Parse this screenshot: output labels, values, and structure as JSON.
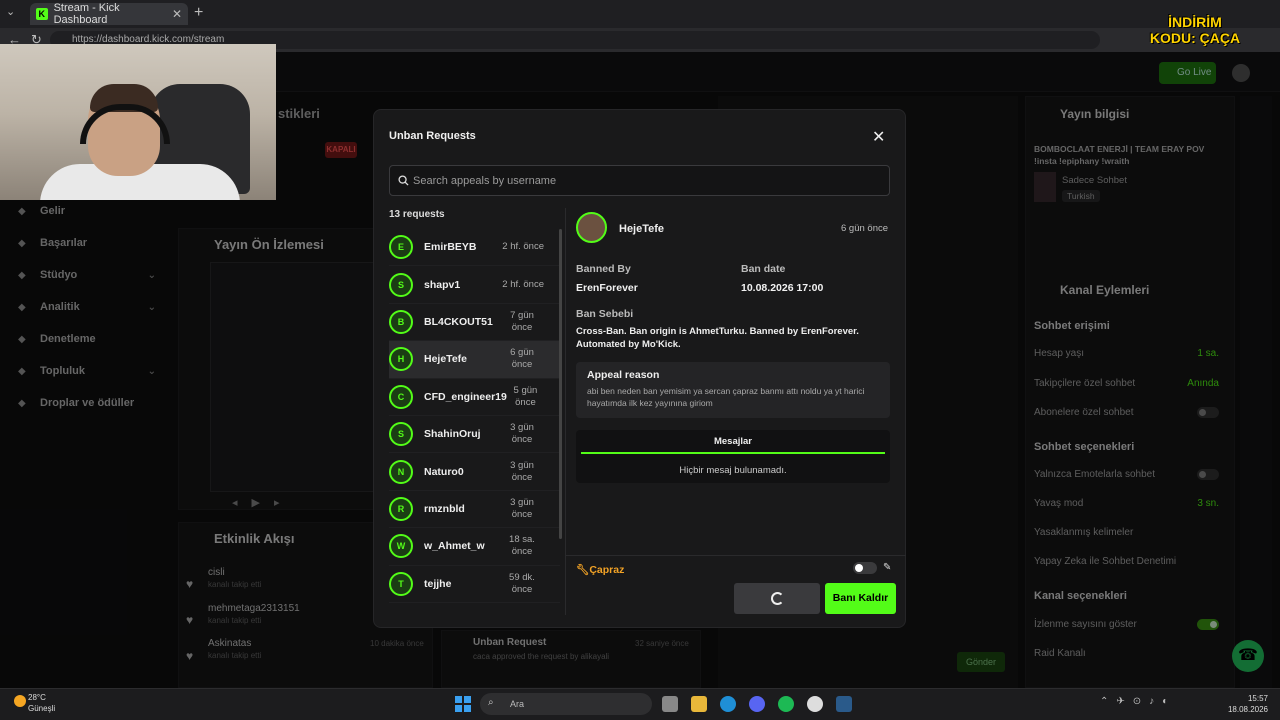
{
  "browser": {
    "tab_title": "Stream - Kick Dashboard",
    "url": "https://dashboard.kick.com/stream",
    "promo": "İNDİRİM KODU: ÇAÇA"
  },
  "dashboard": {
    "go_live": "Go Live",
    "stats_title": "stikleri",
    "status_badge": "KAPALI",
    "sidebar": [
      {
        "label": "Gelir",
        "icon": "dollar-icon",
        "chevron": false
      },
      {
        "label": "Başarılar",
        "icon": "trophy-icon",
        "chevron": false
      },
      {
        "label": "Stüdyo",
        "icon": "studio-icon",
        "chevron": true
      },
      {
        "label": "Analitik",
        "icon": "chart-icon",
        "chevron": true
      },
      {
        "label": "Denetleme",
        "icon": "wrench-icon",
        "chevron": false
      },
      {
        "label": "Topluluk",
        "icon": "users-icon",
        "chevron": true
      },
      {
        "label": "Droplar ve ödüller",
        "icon": "gift-icon",
        "chevron": false
      }
    ],
    "preview_title": "Yayın Ön İzlemesi",
    "activity_title": "Etkinlik Akışı",
    "activity": [
      {
        "user": "cisli",
        "sub": "kanalı takip etti"
      },
      {
        "user": "mehmetaga2313151",
        "sub": "kanalı takip etti"
      },
      {
        "user": "Askinatas",
        "sub": "kanalı takip etti",
        "time": "10 dakika önce"
      }
    ],
    "unban_log": {
      "title": "Unban Request",
      "sub": "caca approved the request by alikayali",
      "time": "32 saniye önce"
    },
    "chat_send": "Gönder",
    "stream_info": {
      "title": "Yayın bilgisi",
      "stream_name": "BOMBOCLAAT ENERJİ | TEAM ERAY POV !insta !epiphany !wraith",
      "category": "Sadece Sohbet",
      "tag": "Turkish"
    },
    "channel_actions": {
      "title": "Kanal Eylemleri",
      "chat_access": "Sohbet erişimi",
      "account_age": "Hesap yaşı",
      "account_age_val": "1 sa.",
      "followers_only": "Takipçilere özel sohbet",
      "followers_only_val": "Anında",
      "subs_only": "Abonelere özel sohbet",
      "chat_options": "Sohbet seçenekleri",
      "emotes_only": "Yalnızca Emotelarla sohbet",
      "slow_mode": "Yavaş mod",
      "slow_mode_val": "3 sn.",
      "banned_words": "Yasaklanmış kelimeler",
      "ai_moderation": "Yapay Zeka ile Sohbet Denetimi",
      "channel_options": "Kanal seçenekleri",
      "show_viewers": "İzlenme sayısını göster",
      "raid": "Raid Kanalı"
    }
  },
  "modal": {
    "title": "Unban Requests",
    "search_placeholder": "Search appeals by username",
    "count_label": "13 requests",
    "requests": [
      {
        "name": "EmirBEYB",
        "time": "2 hf. önce",
        "selected": false
      },
      {
        "name": "shapv1",
        "time": "2 hf. önce",
        "selected": false
      },
      {
        "name": "BL4CKOUT51",
        "time": "7 gün önce",
        "selected": false
      },
      {
        "name": "HejeTefe",
        "time": "6 gün önce",
        "selected": true
      },
      {
        "name": "CFD_engineer19",
        "time": "5 gün önce",
        "selected": false
      },
      {
        "name": "ShahinOruj",
        "time": "3 gün önce",
        "selected": false
      },
      {
        "name": "Naturo0",
        "time": "3 gün önce",
        "selected": false
      },
      {
        "name": "rmznbld",
        "time": "3 gün önce",
        "selected": false
      },
      {
        "name": "w_Ahmet_w",
        "time": "18 sa. önce",
        "selected": false
      },
      {
        "name": "tejjhe",
        "time": "59 dk. önce",
        "selected": false
      }
    ],
    "detail": {
      "username": "HejeTefe",
      "time": "6 gün önce",
      "banned_by_label": "Banned By",
      "banned_by": "ErenForever",
      "ban_date_label": "Ban date",
      "ban_date": "10.08.2026 17:00",
      "reason_label": "Ban Sebebi",
      "reason": "Cross-Ban. Ban origin is AhmetTurku. Banned by ErenForever. Automated by Mo'Kick.",
      "appeal_label": "Appeal reason",
      "appeal_text": "abi ben neden ban yemisim ya sercan çapraz banmı attı noldu ya yt harici hayatımda ilk kez yayınına giriom",
      "messages_tab": "Mesajlar",
      "messages_empty": "Hiçbir mesaj bulunamadı.",
      "cross_label": "Çapraz",
      "unban_button": "Banı Kaldır"
    }
  },
  "taskbar": {
    "weather_temp": "28°C",
    "weather_desc": "Güneşli",
    "search": "Ara",
    "time": "15:57",
    "date": "18.08.2026"
  }
}
